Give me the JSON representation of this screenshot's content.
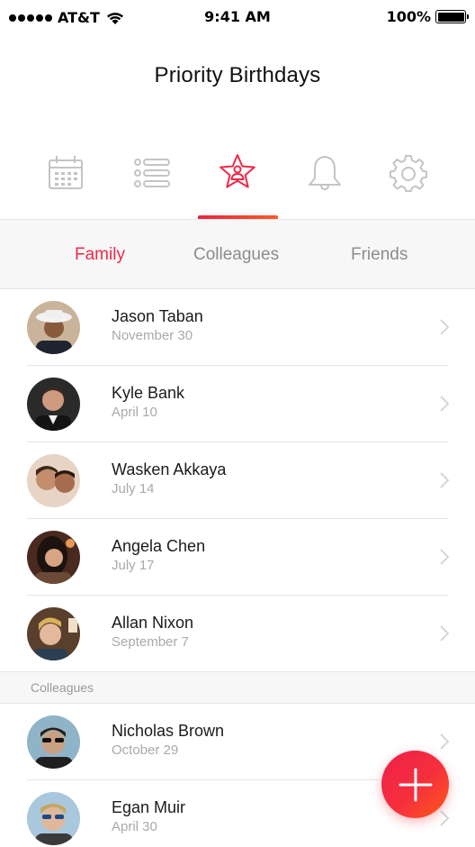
{
  "status_bar": {
    "carrier": "AT&T",
    "time": "9:41 AM",
    "battery": "100%"
  },
  "header": {
    "title": "Priority Birthdays"
  },
  "icon_nav": {
    "items": [
      {
        "icon": "calendar-icon",
        "active": false
      },
      {
        "icon": "list-icon",
        "active": false
      },
      {
        "icon": "star-person-icon",
        "active": true
      },
      {
        "icon": "bell-icon",
        "active": false
      },
      {
        "icon": "gear-icon",
        "active": false
      }
    ],
    "accent": "#ef2848"
  },
  "tabs": [
    {
      "label": "Family",
      "active": true
    },
    {
      "label": "Colleagues",
      "active": false
    },
    {
      "label": "Friends",
      "active": false
    }
  ],
  "family": [
    {
      "name": "Jason Taban",
      "date": "November 30"
    },
    {
      "name": "Kyle Bank",
      "date": "April 10"
    },
    {
      "name": "Wasken Akkaya",
      "date": "July 14"
    },
    {
      "name": "Angela Chen",
      "date": "July 17"
    },
    {
      "name": "Allan Nixon",
      "date": "September 7"
    }
  ],
  "section_colleagues": {
    "title": "Colleagues"
  },
  "colleagues": [
    {
      "name": "Nicholas Brown",
      "date": "October 29"
    },
    {
      "name": "Egan Muir",
      "date": "April 30"
    }
  ],
  "fab": {
    "icon": "plus-icon",
    "colors": [
      "#ee1f4b",
      "#ff5a1a"
    ]
  }
}
